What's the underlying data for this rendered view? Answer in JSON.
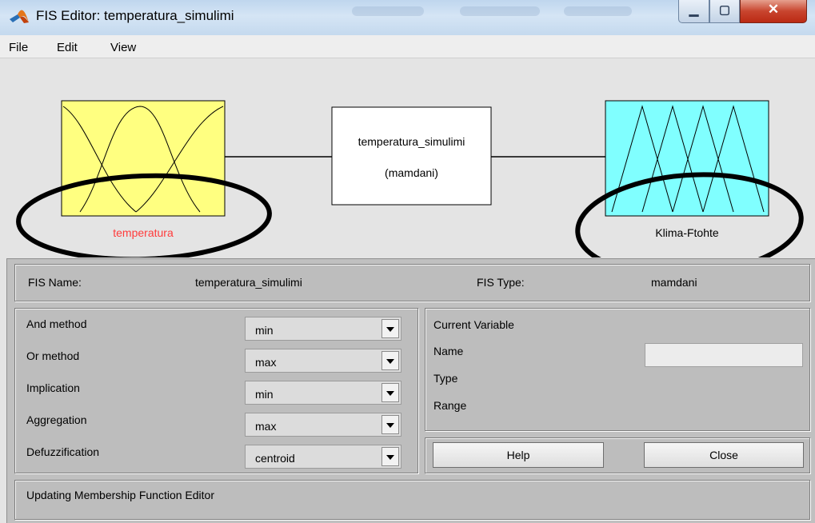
{
  "window": {
    "title": "FIS Editor: temperatura_simulimi"
  },
  "menu": [
    "File",
    "Edit",
    "View"
  ],
  "diagram": {
    "input_label": "temperatura",
    "system_name": "temperatura_simulimi",
    "system_type": "(mamdani)",
    "output_label": "Klima-Ftohte",
    "colors": {
      "input_box": "#ffff80",
      "output_box": "#80ffff",
      "input_label": "#ff3b3b"
    }
  },
  "fis_info": {
    "name_label": "FIS Name:",
    "name_value": "temperatura_simulimi",
    "type_label": "FIS Type:",
    "type_value": "mamdani"
  },
  "methods": [
    {
      "label": "And method",
      "value": "min"
    },
    {
      "label": "Or method",
      "value": "max"
    },
    {
      "label": "Implication",
      "value": "min"
    },
    {
      "label": "Aggregation",
      "value": "max"
    },
    {
      "label": "Defuzzification",
      "value": "centroid"
    }
  ],
  "current_variable": {
    "heading": "Current Variable",
    "name_label": "Name",
    "type_label": "Type",
    "range_label": "Range",
    "name_value": ""
  },
  "buttons": {
    "help": "Help",
    "close": "Close"
  },
  "status": "Updating Membership Function Editor"
}
